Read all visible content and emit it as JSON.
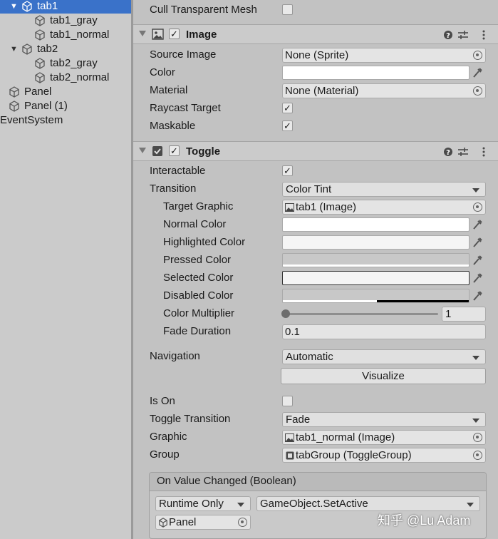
{
  "hierarchy": {
    "items": [
      {
        "label": "tab1",
        "selected": true
      },
      {
        "label": "tab1_gray"
      },
      {
        "label": "tab1_normal"
      },
      {
        "label": "tab2"
      },
      {
        "label": "tab2_gray"
      },
      {
        "label": "tab2_normal"
      },
      {
        "label": "Panel"
      },
      {
        "label": "Panel (1)"
      },
      {
        "label": "EventSystem"
      }
    ]
  },
  "inspector": {
    "cull_transparent_mesh": {
      "label": "Cull Transparent Mesh",
      "checked": false
    },
    "image_component": {
      "title": "Image",
      "enabled": true,
      "source_image": {
        "label": "Source Image",
        "value": "None (Sprite)"
      },
      "color": {
        "label": "Color",
        "value": "#ffffff"
      },
      "material": {
        "label": "Material",
        "value": "None (Material)"
      },
      "raycast_target": {
        "label": "Raycast Target",
        "checked": true
      },
      "maskable": {
        "label": "Maskable",
        "checked": true
      }
    },
    "toggle_component": {
      "title": "Toggle",
      "enabled": true,
      "interactable": {
        "label": "Interactable",
        "checked": true
      },
      "transition": {
        "label": "Transition",
        "value": "Color Tint"
      },
      "target_graphic": {
        "label": "Target Graphic",
        "value": "tab1 (Image)"
      },
      "normal_color": {
        "label": "Normal Color",
        "value": "#ffffff"
      },
      "highlighted_color": {
        "label": "Highlighted Color",
        "value": "#f5f5f5"
      },
      "pressed_color": {
        "label": "Pressed Color",
        "value": "#c8c8c8"
      },
      "selected_color": {
        "label": "Selected Color",
        "value": "#f5f5f5"
      },
      "disabled_color": {
        "label": "Disabled Color",
        "value": "#c8c8c8"
      },
      "color_multiplier": {
        "label": "Color Multiplier",
        "value": "1"
      },
      "fade_duration": {
        "label": "Fade Duration",
        "value": "0.1"
      },
      "navigation": {
        "label": "Navigation",
        "value": "Automatic"
      },
      "visualize_label": "Visualize",
      "is_on": {
        "label": "Is On",
        "checked": false
      },
      "toggle_transition": {
        "label": "Toggle Transition",
        "value": "Fade"
      },
      "graphic": {
        "label": "Graphic",
        "value": "tab1_normal (Image)"
      },
      "group": {
        "label": "Group",
        "value": "tabGroup (ToggleGroup)"
      },
      "on_value_changed": {
        "title": "On Value Changed (Boolean)",
        "runtime": "Runtime Only",
        "function": "GameObject.SetActive",
        "object": "Panel"
      }
    }
  },
  "watermark": "知乎 @Lu Adam",
  "colors": {
    "selection": "#3a72c9",
    "panel_bg": "#c2c2c2",
    "field_bg": "#e4e4e4"
  }
}
